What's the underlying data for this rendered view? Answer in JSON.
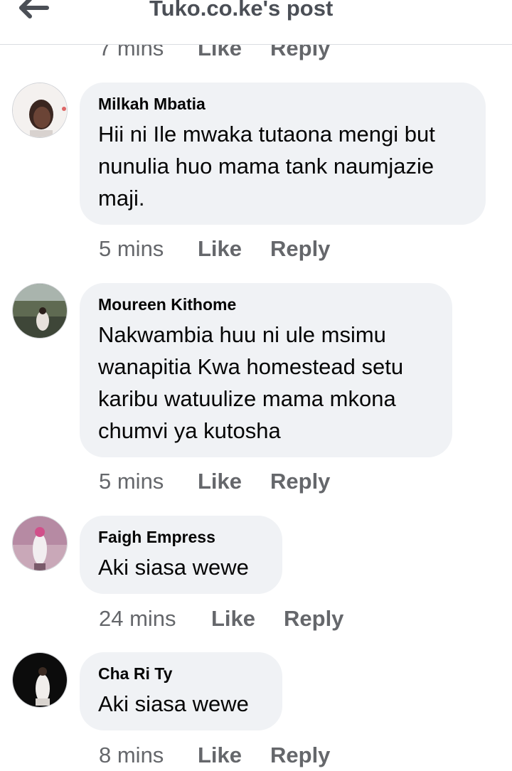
{
  "header": {
    "title": "Tuko.co.ke's post",
    "back_icon": "back-arrow-icon"
  },
  "actions": {
    "like_label": "Like",
    "reply_label": "Reply"
  },
  "top_partial": {
    "time": "7 mins"
  },
  "comments": [
    {
      "author": "Milkah Mbatia",
      "text": "Hii ni Ile mwaka tutaona mengi but nunulia huo mama tank naumjazie maji.",
      "time": "5 mins"
    },
    {
      "author": "Moureen Kithome",
      "text": "Nakwambia huu ni ule msimu wanapitia Kwa homestead setu karibu watuulize mama mkona chumvi ya kutosha",
      "time": "5 mins"
    },
    {
      "author": "Faigh Empress",
      "text": "Aki siasa wewe",
      "time": "24 mins"
    },
    {
      "author": "Cha Ri Ty",
      "text": "Aki siasa wewe",
      "time": "8 mins"
    }
  ],
  "colors": {
    "bubble": "#f0f2f5",
    "meta_text": "#65676b",
    "title_text": "#4b4f56"
  }
}
